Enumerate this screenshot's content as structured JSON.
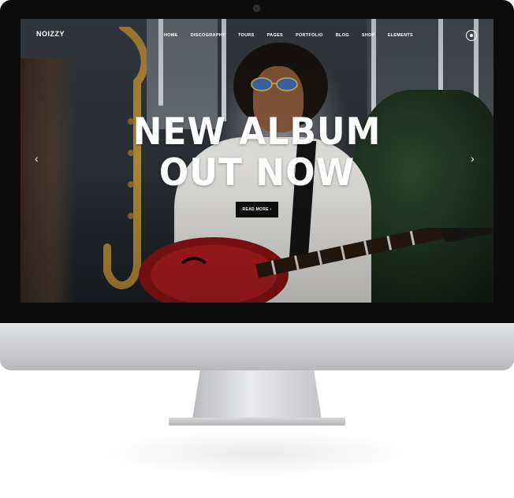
{
  "site": {
    "logo": "NOIZZY",
    "nav": [
      "HOME",
      "DISCOGRAPHY",
      "TOURS",
      "PAGES",
      "PORTFOLIO",
      "BLOG",
      "SHOP",
      "ELEMENTS"
    ]
  },
  "hero": {
    "headline_line1": "NEW ALBUM",
    "headline_line2": "OUT NOW",
    "cta_label": "READ MORE ›",
    "prev_arrow": "‹",
    "next_arrow": "›"
  },
  "icons": {
    "menu": "circle-menu-icon",
    "prev": "chevron-left-icon",
    "next": "chevron-right-icon"
  },
  "colors": {
    "cta_background": "#0d0d0d",
    "text": "#ffffff"
  }
}
